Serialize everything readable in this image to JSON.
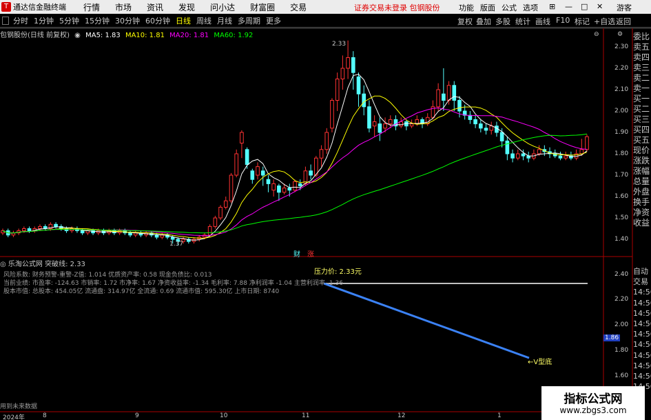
{
  "app": {
    "name": "通达信金融终端",
    "logo_char": "T"
  },
  "menu": [
    "行情",
    "市场",
    "资讯",
    "发现",
    "问小达",
    "财富圈",
    "交易"
  ],
  "notice": "证券交易未登录  包钢股份",
  "right_menu": [
    "功能",
    "版面",
    "公式",
    "选项"
  ],
  "guest": "游客",
  "toolbar": {
    "periods": [
      "分时",
      "1分钟",
      "5分钟",
      "15分钟",
      "30分钟",
      "60分钟",
      "日线",
      "周线",
      "月线",
      "多周期",
      "更多"
    ],
    "active": "日线",
    "right": [
      "复权",
      "叠加",
      "多股",
      "统计",
      "画线",
      "F10",
      "标记",
      "+自选",
      "返回"
    ]
  },
  "info": {
    "title": "包钢股份(日线 前复权)",
    "ma5": "MA5: 1.83",
    "ma10": "MA10: 1.81",
    "ma20": "MA20: 1.81",
    "ma60": "MA60: 1.92"
  },
  "colors": {
    "up": "#ff3232",
    "down": "#54ffff",
    "ma5": "#ffffff",
    "ma10": "#ffff00",
    "ma20": "#ff00ff",
    "ma60": "#00ff00",
    "blue": "#3b82f6"
  },
  "price_axis": [
    "2.30",
    "2.20",
    "2.10",
    "2.00",
    "1.90",
    "1.80",
    "1.70",
    "1.60",
    "1.50",
    "1.40"
  ],
  "high_label": "2.33",
  "low_label": "1.37",
  "markers": {
    "cai": "财",
    "zhang": "涨"
  },
  "indicator": {
    "title": "乐淘公式网 突破线: 2.33",
    "stat1": "风险系数: 财务预警-重警-Z值: 1.014 优质资产率: 0.58 现金负债比: 0.013",
    "stat2": "当前业绩: 市盈率: -124.63 市销率: 1.72 市净率: 1.67 净资收益率: -1.34 毛利率: 7.88 净利润率 -1.04 主营利润率 -1.36",
    "stat3": "股本市值: 总股本: 454.05亿 流通盘: 314.97亿 全流通: 0.69 流通市值: 595.30亿 上市日期: 8740",
    "pressure": "压力价: 2.33元",
    "vlabel": "←V型底",
    "current": "1.86",
    "axis": [
      "2.40",
      "2.20",
      "2.00",
      "1.80",
      "1.60"
    ]
  },
  "x_labels": [
    "2024年",
    "8",
    "9",
    "10",
    "11",
    "12",
    "1"
  ],
  "bottom_status": "用到未来数据",
  "right_panel": [
    "委比",
    "卖五",
    "卖四",
    "卖三",
    "卖二",
    "卖一",
    "买一",
    "买二",
    "买三",
    "买四",
    "买五",
    "现价",
    "涨跌",
    "涨幅",
    "总量",
    "外盘",
    "换手",
    "净资",
    "收益"
  ],
  "right_panel2": [
    "自动",
    "交易",
    "14:56",
    "14:56",
    "14:56",
    "14:56",
    "14:56",
    "14:56",
    "14:56",
    "14:56",
    "14:56",
    "14:56"
  ],
  "watermark": {
    "line1": "指标公式网",
    "line2": "www.zbgs3.com"
  },
  "chart_data": {
    "type": "candlestick",
    "ylim": [
      1.35,
      2.35
    ],
    "x_labels": [
      "2024年",
      "8",
      "9",
      "10",
      "11",
      "12",
      "1"
    ],
    "candles": [
      [
        1.43,
        1.44,
        1.42,
        1.45
      ],
      [
        1.44,
        1.42,
        1.41,
        1.45
      ],
      [
        1.42,
        1.43,
        1.41,
        1.44
      ],
      [
        1.43,
        1.44,
        1.42,
        1.45
      ],
      [
        1.44,
        1.45,
        1.43,
        1.46
      ],
      [
        1.45,
        1.44,
        1.43,
        1.46
      ],
      [
        1.44,
        1.45,
        1.43,
        1.46
      ],
      [
        1.45,
        1.46,
        1.44,
        1.47
      ],
      [
        1.46,
        1.45,
        1.44,
        1.47
      ],
      [
        1.45,
        1.47,
        1.44,
        1.48
      ],
      [
        1.47,
        1.46,
        1.45,
        1.48
      ],
      [
        1.46,
        1.45,
        1.44,
        1.47
      ],
      [
        1.45,
        1.44,
        1.43,
        1.46
      ],
      [
        1.44,
        1.45,
        1.43,
        1.46
      ],
      [
        1.45,
        1.44,
        1.43,
        1.46
      ],
      [
        1.44,
        1.43,
        1.42,
        1.45
      ],
      [
        1.43,
        1.44,
        1.42,
        1.45
      ],
      [
        1.44,
        1.43,
        1.42,
        1.45
      ],
      [
        1.43,
        1.44,
        1.42,
        1.45
      ],
      [
        1.44,
        1.43,
        1.42,
        1.45
      ],
      [
        1.43,
        1.44,
        1.42,
        1.45
      ],
      [
        1.44,
        1.43,
        1.42,
        1.45
      ],
      [
        1.43,
        1.44,
        1.42,
        1.45
      ],
      [
        1.44,
        1.43,
        1.42,
        1.45
      ],
      [
        1.43,
        1.42,
        1.41,
        1.44
      ],
      [
        1.42,
        1.43,
        1.41,
        1.44
      ],
      [
        1.43,
        1.42,
        1.41,
        1.44
      ],
      [
        1.42,
        1.43,
        1.41,
        1.44
      ],
      [
        1.43,
        1.42,
        1.41,
        1.44
      ],
      [
        1.42,
        1.41,
        1.4,
        1.43
      ],
      [
        1.41,
        1.42,
        1.4,
        1.43
      ],
      [
        1.42,
        1.41,
        1.4,
        1.43
      ],
      [
        1.41,
        1.4,
        1.38,
        1.42
      ],
      [
        1.4,
        1.39,
        1.37,
        1.41
      ],
      [
        1.39,
        1.4,
        1.38,
        1.41
      ],
      [
        1.4,
        1.39,
        1.38,
        1.41
      ],
      [
        1.39,
        1.4,
        1.38,
        1.41
      ],
      [
        1.4,
        1.41,
        1.39,
        1.42
      ],
      [
        1.41,
        1.42,
        1.4,
        1.43
      ],
      [
        1.42,
        1.46,
        1.41,
        1.47
      ],
      [
        1.46,
        1.5,
        1.45,
        1.51
      ],
      [
        1.5,
        1.55,
        1.49,
        1.56
      ],
      [
        1.55,
        1.58,
        1.54,
        1.6
      ],
      [
        1.58,
        1.7,
        1.57,
        1.71
      ],
      [
        1.7,
        1.8,
        1.69,
        1.82
      ],
      [
        1.85,
        1.9,
        1.78,
        1.91
      ],
      [
        1.82,
        1.75,
        1.73,
        1.83
      ],
      [
        1.72,
        1.68,
        1.66,
        1.73
      ],
      [
        1.7,
        1.74,
        1.68,
        1.76
      ],
      [
        1.72,
        1.7,
        1.65,
        1.74
      ],
      [
        1.68,
        1.66,
        1.62,
        1.7
      ],
      [
        1.63,
        1.66,
        1.6,
        1.68
      ],
      [
        1.65,
        1.62,
        1.58,
        1.66
      ],
      [
        1.62,
        1.64,
        1.61,
        1.66
      ],
      [
        1.64,
        1.63,
        1.6,
        1.66
      ],
      [
        1.63,
        1.67,
        1.62,
        1.68
      ],
      [
        1.66,
        1.65,
        1.63,
        1.68
      ],
      [
        1.66,
        1.72,
        1.65,
        1.74
      ],
      [
        1.72,
        1.7,
        1.68,
        1.75
      ],
      [
        1.7,
        1.78,
        1.69,
        1.79
      ],
      [
        1.78,
        1.82,
        1.74,
        1.84
      ],
      [
        1.82,
        1.9,
        1.8,
        1.92
      ],
      [
        1.92,
        2.05,
        1.9,
        2.06
      ],
      [
        2.05,
        2.15,
        2.0,
        2.18
      ],
      [
        2.15,
        2.2,
        2.1,
        2.26
      ],
      [
        2.2,
        2.25,
        2.15,
        2.33
      ],
      [
        2.25,
        2.18,
        2.1,
        2.28
      ],
      [
        2.16,
        2.08,
        2.02,
        2.18
      ],
      [
        2.08,
        2.02,
        1.98,
        2.12
      ],
      [
        2.02,
        1.92,
        1.9,
        2.05
      ],
      [
        1.93,
        1.95,
        1.88,
        1.98
      ],
      [
        1.94,
        1.9,
        1.86,
        1.97
      ],
      [
        1.92,
        1.94,
        1.9,
        1.97
      ],
      [
        1.94,
        1.96,
        1.92,
        1.98
      ],
      [
        1.96,
        1.93,
        1.91,
        1.98
      ],
      [
        1.93,
        1.95,
        1.92,
        1.97
      ],
      [
        1.95,
        1.93,
        1.91,
        1.96
      ],
      [
        1.93,
        1.94,
        1.92,
        1.96
      ],
      [
        1.94,
        1.96,
        1.93,
        1.98
      ],
      [
        1.96,
        1.94,
        1.92,
        1.97
      ],
      [
        1.94,
        1.97,
        1.93,
        1.99
      ],
      [
        1.97,
        2.02,
        1.96,
        2.05
      ],
      [
        2.02,
        2.1,
        2.0,
        2.13
      ],
      [
        2.08,
        2.05,
        2.0,
        2.2
      ],
      [
        2.05,
        2.12,
        2.03,
        2.14
      ],
      [
        2.12,
        2.05,
        2.0,
        2.14
      ],
      [
        2.05,
        2.0,
        1.97,
        2.07
      ],
      [
        2.0,
        1.98,
        1.96,
        2.03
      ],
      [
        1.98,
        1.96,
        1.94,
        2.0
      ],
      [
        1.96,
        1.94,
        1.92,
        1.98
      ],
      [
        1.94,
        1.92,
        1.9,
        1.96
      ],
      [
        1.92,
        1.91,
        1.89,
        1.94
      ],
      [
        1.91,
        1.93,
        1.89,
        1.95
      ],
      [
        1.93,
        1.9,
        1.88,
        1.95
      ],
      [
        1.9,
        1.86,
        1.83,
        1.92
      ],
      [
        1.86,
        1.8,
        1.77,
        1.88
      ],
      [
        1.8,
        1.78,
        1.76,
        1.82
      ],
      [
        1.78,
        1.8,
        1.77,
        1.82
      ],
      [
        1.8,
        1.79,
        1.77,
        1.82
      ],
      [
        1.79,
        1.78,
        1.76,
        1.81
      ],
      [
        1.78,
        1.8,
        1.77,
        1.82
      ],
      [
        1.8,
        1.82,
        1.79,
        1.84
      ],
      [
        1.82,
        1.81,
        1.79,
        1.84
      ],
      [
        1.81,
        1.8,
        1.78,
        1.83
      ],
      [
        1.8,
        1.79,
        1.78,
        1.82
      ],
      [
        1.79,
        1.78,
        1.77,
        1.81
      ],
      [
        1.78,
        1.79,
        1.77,
        1.81
      ],
      [
        1.79,
        1.78,
        1.77,
        1.81
      ],
      [
        1.78,
        1.8,
        1.77,
        1.82
      ],
      [
        1.8,
        1.82,
        1.79,
        1.87
      ],
      [
        1.82,
        1.88,
        1.81,
        1.89
      ]
    ]
  }
}
